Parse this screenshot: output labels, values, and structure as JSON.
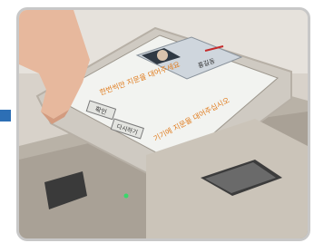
{
  "photo": {
    "subject": "hand touching kiosk touchscreen",
    "screen": {
      "heading_line1": "한번씩만 지문을 대어주세요",
      "heading_line2": "기기에 지문을 대어주십시오",
      "name_label": "홍길동",
      "button_confirm": "확인",
      "button_cancel": "다시하기"
    },
    "colors": {
      "accent_bar": "#2d6fb5",
      "screen_bg": "#f2f3f0",
      "text_orange": "#e07a1a",
      "card_bg": "#cfd6dd",
      "device_metal": "#bdb6ab"
    }
  }
}
